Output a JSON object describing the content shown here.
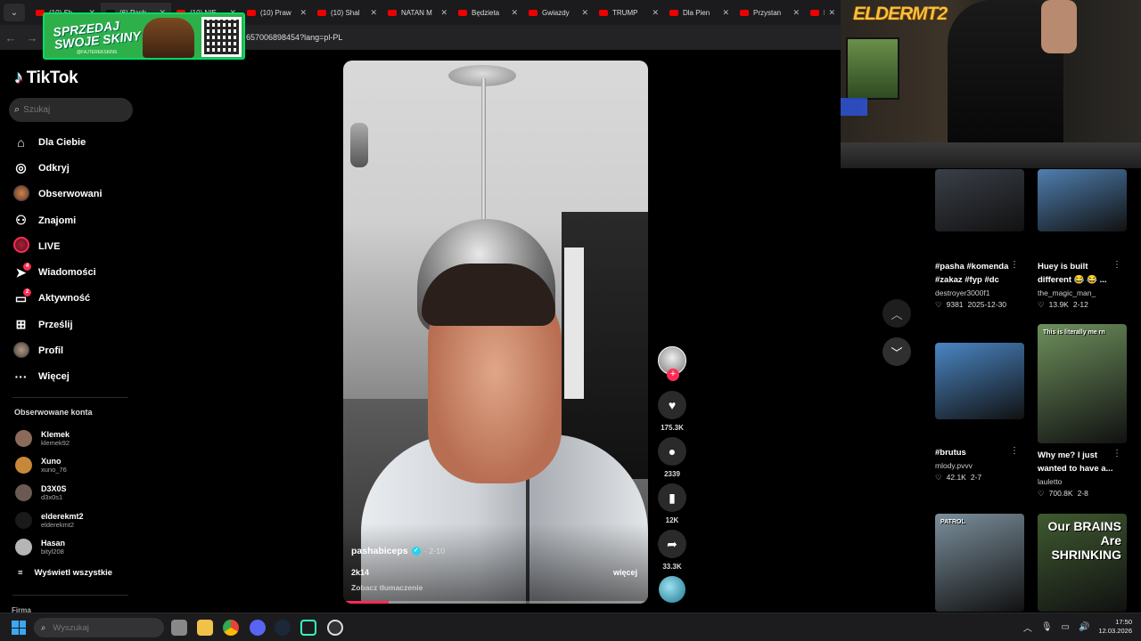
{
  "browser": {
    "tabs": [
      {
        "label": "(10) Sh"
      },
      {
        "label": "(6) Pash"
      },
      {
        "label": "(10) NIE"
      },
      {
        "label": "(10) Praw"
      },
      {
        "label": "(10) Shal"
      },
      {
        "label": "NATAN M"
      },
      {
        "label": "Będzieta"
      },
      {
        "label": "Gwiazdy"
      },
      {
        "label": "TRUMP"
      },
      {
        "label": "Dla Pien"
      },
      {
        "label": "Przystan"
      },
      {
        "label": "DELOR"
      }
    ],
    "url": "657006898454?lang=pl-PL"
  },
  "promo": {
    "line1": "SPRZEDAJ",
    "line2": "SWOJE SKINY",
    "handle": "@FAJTEREKSKINS"
  },
  "sidebar": {
    "logo": "TikTok",
    "search_placeholder": "Szukaj",
    "nav": [
      {
        "label": "Dla Ciebie",
        "icon": "home-icon"
      },
      {
        "label": "Odkryj",
        "icon": "compass-icon"
      },
      {
        "label": "Obserwowani",
        "icon": "avatar-icon"
      },
      {
        "label": "Znajomi",
        "icon": "friends-icon"
      },
      {
        "label": "LIVE",
        "icon": "live-icon"
      },
      {
        "label": "Wiadomości",
        "icon": "send-icon",
        "badge": "4"
      },
      {
        "label": "Aktywność",
        "icon": "message-icon",
        "badge": "2"
      },
      {
        "label": "Prześlij",
        "icon": "plus-square-icon"
      },
      {
        "label": "Profil",
        "icon": "profile-icon"
      },
      {
        "label": "Więcej",
        "icon": "more-icon"
      }
    ],
    "followed_title": "Obserwowane konta",
    "followed": [
      {
        "name": "Klemek",
        "handle": "klemek92",
        "color": "#8a6a5a"
      },
      {
        "name": "Xuno",
        "handle": "xuno_76",
        "color": "#c7883a"
      },
      {
        "name": "D3X0S",
        "handle": "d3x0s1",
        "color": "#6c5a52"
      },
      {
        "name": "elderekmt2",
        "handle": "elderekmt2",
        "color": "#1a1a1a"
      },
      {
        "name": "Hasan",
        "handle": "bityl208",
        "color": "#b5b5b5"
      }
    ],
    "show_all": "Wyświetl wszystkie",
    "footer": "Firma"
  },
  "video": {
    "author": "pashabiceps",
    "date": "· 2-10",
    "caption": "2k14",
    "translate": "Zobacz tłumaczenie",
    "more": "więcej",
    "progress": 0.15
  },
  "actions": {
    "likes": "175.3K",
    "comments": "2339",
    "saves": "12K",
    "shares": "33.3K"
  },
  "webcam": {
    "logo": "ELDERMT2"
  },
  "related": [
    {
      "title": "#pasha #komenda #zakaz #fyp #dc",
      "author": "destroyer3000f1",
      "likes": "9381",
      "date": "2025-12-30",
      "thumb": "#3a3f48"
    },
    {
      "title": "Huey is built different 😂 😂 ...",
      "author": "the_magic_man_",
      "likes": "13.9K",
      "date": "2-12",
      "thumb": "#4f7fb0"
    },
    {
      "title": "#brutus",
      "author": "mlody.pvvv",
      "likes": "42.1K",
      "date": "2-7",
      "thumb": "#4a86c4"
    },
    {
      "title": "Why me? I just wanted to have a...",
      "author": "lauletto",
      "likes": "700.8K",
      "date": "2-8",
      "thumb": "#6d8f5c",
      "overlay": "This is literally me rn"
    },
    {
      "title": "",
      "author": "",
      "likes": "",
      "date": "",
      "thumb": "#7b8f9c",
      "overlay": "PATROL"
    },
    {
      "title": "",
      "author": "",
      "likes": "",
      "date": "",
      "thumb": "#3f5a30",
      "overlay": "Our BRAINS Are SHRINKING"
    }
  ],
  "taskbar": {
    "search_placeholder": "Wyszukaj",
    "time": "17:50",
    "date": "12.03.2026"
  }
}
